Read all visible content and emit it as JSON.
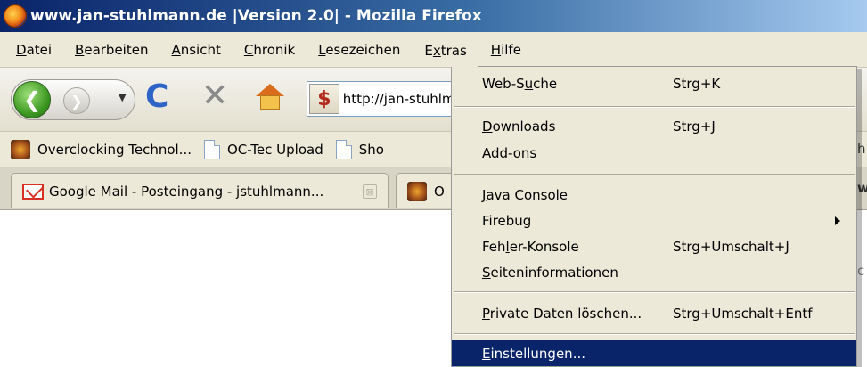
{
  "window": {
    "title": "www.jan-stuhlmann.de |Version 2.0| - Mozilla Firefox"
  },
  "menubar": {
    "items": [
      {
        "pre": "",
        "key": "D",
        "post": "atei"
      },
      {
        "pre": "",
        "key": "B",
        "post": "earbeiten"
      },
      {
        "pre": "",
        "key": "A",
        "post": "nsicht"
      },
      {
        "pre": "",
        "key": "C",
        "post": "hronik"
      },
      {
        "pre": "",
        "key": "L",
        "post": "esezeichen"
      },
      {
        "pre": "E",
        "key": "x",
        "post": "tras"
      },
      {
        "pre": "",
        "key": "H",
        "post": "ilfe"
      }
    ]
  },
  "navbar": {
    "back_glyph": "❮",
    "forward_glyph": "❯",
    "dropdown_glyph": "▼",
    "reload_glyph": "C",
    "stop_glyph": "✕",
    "site_icon_glyph": "$",
    "url": "http://jan-stuhlmann.de/"
  },
  "bookmarks": {
    "items": [
      {
        "label": "Overclocking Technol...",
        "icon": "oc-icon"
      },
      {
        "label": "OC-Tec Upload",
        "icon": "page-icon"
      },
      {
        "label": "Sho",
        "icon": "page-icon"
      }
    ],
    "right_peek": "h"
  },
  "tabs": {
    "items": [
      {
        "label": "Google Mail - Posteingang - jstuhlmann...",
        "close_glyph": "⊠",
        "icon": "gmail-icon"
      },
      {
        "label": "O",
        "icon": "oc-icon"
      }
    ],
    "right_peek": "w"
  },
  "content": {
    "right_peek": "c"
  },
  "extras_menu": {
    "items": [
      {
        "pre": "Web-S",
        "key": "u",
        "post": "che",
        "shortcut": "Strg+K"
      },
      {
        "pre": "",
        "key": "D",
        "post": "ownloads",
        "shortcut": "Strg+J"
      },
      {
        "pre": "",
        "key": "A",
        "post": "dd-ons",
        "shortcut": ""
      },
      {
        "pre": "",
        "key": "J",
        "post": "ava Console",
        "shortcut": ""
      },
      {
        "pre": "Firebug",
        "key": "",
        "post": "",
        "shortcut": ""
      },
      {
        "pre": "Feh",
        "key": "l",
        "post": "er-Konsole",
        "shortcut": "Strg+Umschalt+J"
      },
      {
        "pre": "",
        "key": "S",
        "post": "eiteninformationen",
        "shortcut": ""
      },
      {
        "pre": "",
        "key": "P",
        "post": "rivate Daten löschen...",
        "shortcut": "Strg+Umschalt+Entf"
      },
      {
        "pre": "",
        "key": "E",
        "post": "instellungen...",
        "shortcut": ""
      }
    ]
  }
}
